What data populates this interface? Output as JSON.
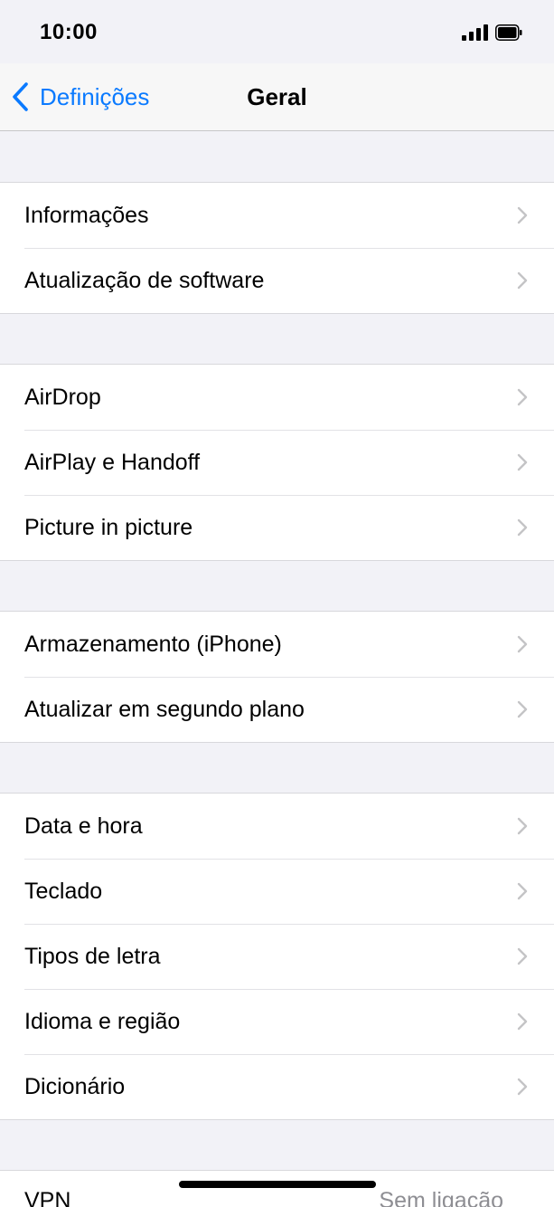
{
  "status_bar": {
    "time": "10:00",
    "signal_icon": "cellular-signal-icon",
    "battery_icon": "battery-icon"
  },
  "nav": {
    "back_label": "Definições",
    "title": "Geral",
    "back_icon": "chevron-left-icon"
  },
  "groups": [
    {
      "items": [
        {
          "label": "Informações"
        },
        {
          "label": "Atualização de software"
        }
      ]
    },
    {
      "items": [
        {
          "label": "AirDrop"
        },
        {
          "label": "AirPlay e Handoff"
        },
        {
          "label": "Picture in picture"
        }
      ]
    },
    {
      "items": [
        {
          "label": "Armazenamento (iPhone)"
        },
        {
          "label": "Atualizar em segundo plano"
        }
      ]
    },
    {
      "items": [
        {
          "label": "Data e hora"
        },
        {
          "label": "Teclado"
        },
        {
          "label": "Tipos de letra"
        },
        {
          "label": "Idioma e região"
        },
        {
          "label": "Dicionário"
        }
      ]
    }
  ],
  "partial_row": {
    "label": "VPN",
    "value": "Sem ligação"
  },
  "colors": {
    "accent": "#0a7aff",
    "background": "#f2f2f7",
    "cell": "#ffffff",
    "chevron": "#c4c4c6",
    "secondary_text": "#8e8e93"
  }
}
